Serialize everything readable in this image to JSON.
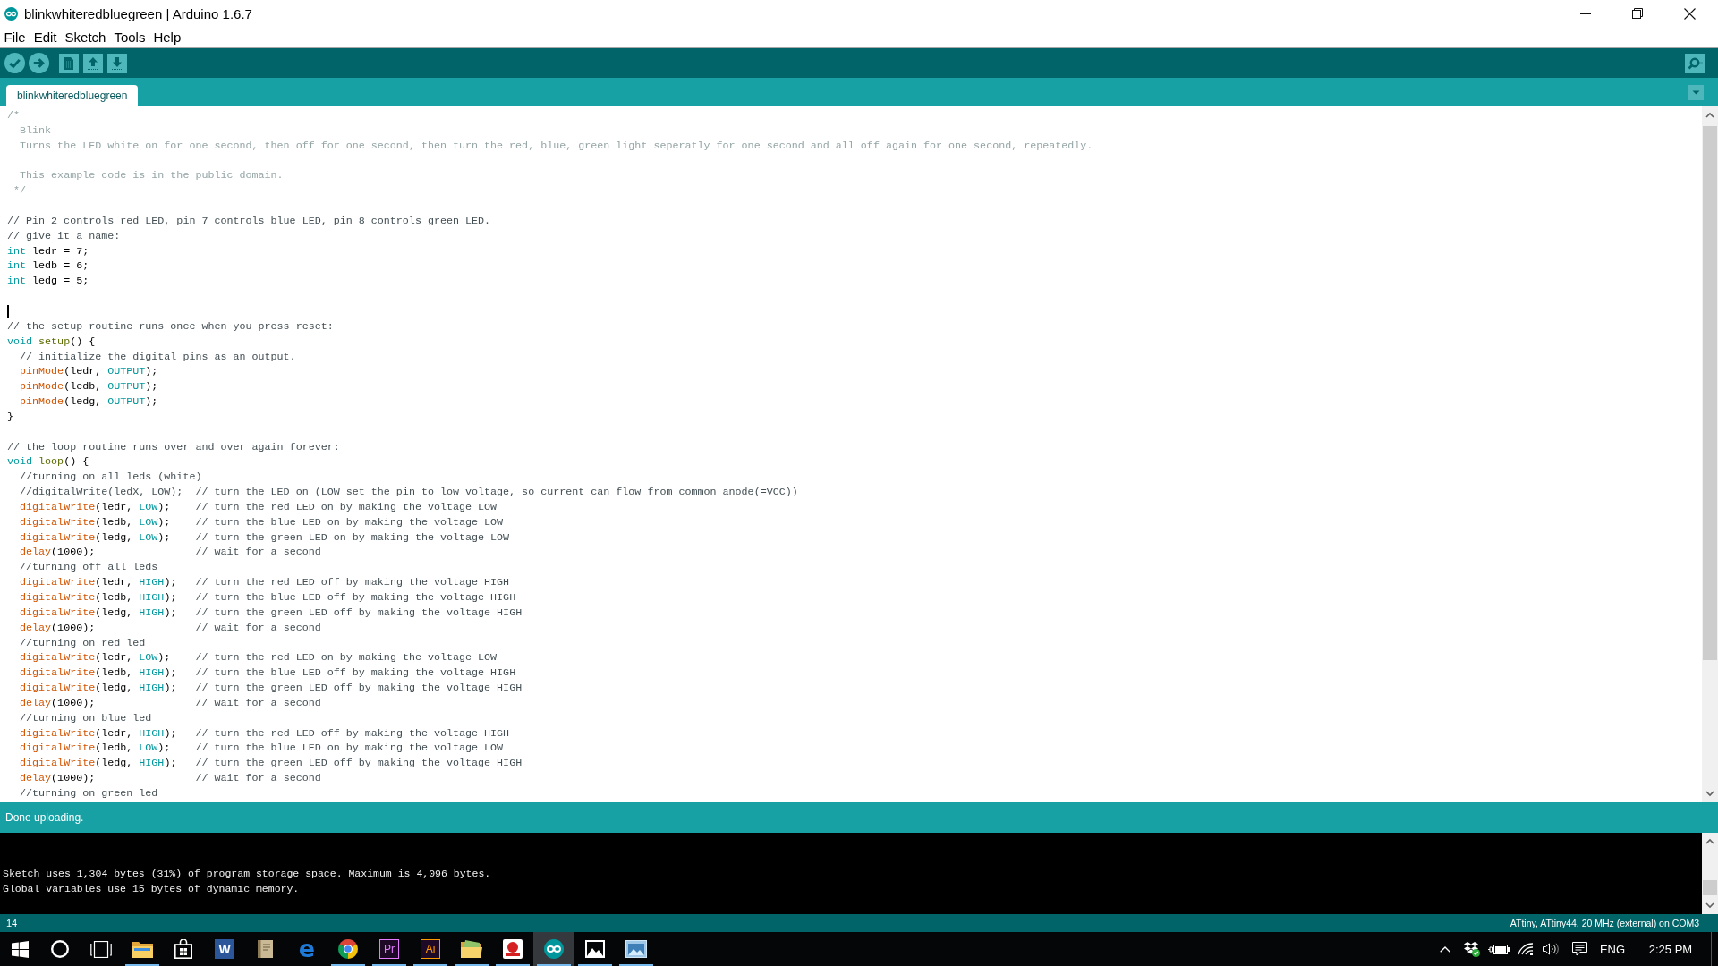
{
  "window": {
    "title": "blinkwhiteredbluegreen | Arduino 1.6.7"
  },
  "menu": [
    "File",
    "Edit",
    "Sketch",
    "Tools",
    "Help"
  ],
  "tabs": [
    {
      "label": "blinkwhiteredbluegreen",
      "selected": true
    }
  ],
  "editor": {
    "lines": [
      {
        "kind": "code",
        "tokens": [
          {
            "kind": "block_comment",
            "text": "/*"
          }
        ]
      },
      {
        "kind": "code",
        "tokens": [
          {
            "kind": "block_comment",
            "text": "  Blink"
          }
        ]
      },
      {
        "kind": "code",
        "tokens": [
          {
            "kind": "block_comment",
            "text": "  Turns the LED white on for one second, then off for one second, then turn the red, blue, green light seperatly for one second and all off again for one second, repeatedly."
          }
        ]
      },
      {
        "kind": "blank"
      },
      {
        "kind": "code",
        "tokens": [
          {
            "kind": "block_comment",
            "text": "  This example code is in the public domain."
          }
        ]
      },
      {
        "kind": "code",
        "tokens": [
          {
            "kind": "block_comment",
            "text": " */"
          }
        ]
      },
      {
        "kind": "blank"
      },
      {
        "kind": "code",
        "tokens": [
          {
            "kind": "comment",
            "text": "// Pin 2 controls red LED, pin 7 controls blue LED, pin 8 controls green LED."
          }
        ]
      },
      {
        "kind": "code",
        "tokens": [
          {
            "kind": "comment",
            "text": "// give it a name:"
          }
        ]
      },
      {
        "kind": "code",
        "tokens": [
          {
            "kind": "keyword",
            "text": "int"
          },
          {
            "kind": "plain",
            "text": " ledr = 7;"
          }
        ]
      },
      {
        "kind": "code",
        "tokens": [
          {
            "kind": "keyword",
            "text": "int"
          },
          {
            "kind": "plain",
            "text": " ledb = 6;"
          }
        ]
      },
      {
        "kind": "code",
        "tokens": [
          {
            "kind": "keyword",
            "text": "int"
          },
          {
            "kind": "plain",
            "text": " ledg = 5;"
          }
        ]
      },
      {
        "kind": "blank"
      },
      {
        "kind": "blank",
        "cursor": true
      },
      {
        "kind": "code",
        "tokens": [
          {
            "kind": "comment",
            "text": "// the setup routine runs once when you press reset:"
          }
        ]
      },
      {
        "kind": "code",
        "tokens": [
          {
            "kind": "keyword",
            "text": "void"
          },
          {
            "kind": "structure",
            "text": " setup"
          },
          {
            "kind": "plain",
            "text": "() {"
          }
        ]
      },
      {
        "kind": "code",
        "tokens": [
          {
            "kind": "comment",
            "text": "  // initialize the digital pins as an output."
          }
        ]
      },
      {
        "kind": "code",
        "tokens": [
          {
            "kind": "function",
            "text": "  pinMode"
          },
          {
            "kind": "plain",
            "text": "(ledr, "
          },
          {
            "kind": "keyword",
            "text": "OUTPUT"
          },
          {
            "kind": "plain",
            "text": ");"
          }
        ]
      },
      {
        "kind": "code",
        "tokens": [
          {
            "kind": "function",
            "text": "  pinMode"
          },
          {
            "kind": "plain",
            "text": "(ledb, "
          },
          {
            "kind": "keyword",
            "text": "OUTPUT"
          },
          {
            "kind": "plain",
            "text": ");"
          }
        ]
      },
      {
        "kind": "code",
        "tokens": [
          {
            "kind": "function",
            "text": "  pinMode"
          },
          {
            "kind": "plain",
            "text": "(ledg, "
          },
          {
            "kind": "keyword",
            "text": "OUTPUT"
          },
          {
            "kind": "plain",
            "text": ");"
          }
        ]
      },
      {
        "kind": "code",
        "tokens": [
          {
            "kind": "plain",
            "text": "}"
          }
        ]
      },
      {
        "kind": "blank"
      },
      {
        "kind": "code",
        "tokens": [
          {
            "kind": "comment",
            "text": "// the loop routine runs over and over again forever:"
          }
        ]
      },
      {
        "kind": "code",
        "tokens": [
          {
            "kind": "keyword",
            "text": "void"
          },
          {
            "kind": "structure",
            "text": " loop"
          },
          {
            "kind": "plain",
            "text": "() {"
          }
        ]
      },
      {
        "kind": "code",
        "tokens": [
          {
            "kind": "comment",
            "text": "  //turning on all leds (white)"
          }
        ]
      },
      {
        "kind": "code",
        "tokens": [
          {
            "kind": "comment",
            "text": "  //digitalWrite(ledX, LOW);  // turn the LED on (LOW set the pin to low voltage, so current can flow from common anode(=VCC))"
          }
        ]
      },
      {
        "kind": "code",
        "tokens": [
          {
            "kind": "function",
            "text": "  digitalWrite"
          },
          {
            "kind": "plain",
            "text": "(ledr, "
          },
          {
            "kind": "keyword",
            "text": "LOW"
          },
          {
            "kind": "plain",
            "text": ");    "
          },
          {
            "kind": "comment",
            "text": "// turn the red LED on by making the voltage LOW"
          }
        ]
      },
      {
        "kind": "code",
        "tokens": [
          {
            "kind": "function",
            "text": "  digitalWrite"
          },
          {
            "kind": "plain",
            "text": "(ledb, "
          },
          {
            "kind": "keyword",
            "text": "LOW"
          },
          {
            "kind": "plain",
            "text": ");    "
          },
          {
            "kind": "comment",
            "text": "// turn the blue LED on by making the voltage LOW"
          }
        ]
      },
      {
        "kind": "code",
        "tokens": [
          {
            "kind": "function",
            "text": "  digitalWrite"
          },
          {
            "kind": "plain",
            "text": "(ledg, "
          },
          {
            "kind": "keyword",
            "text": "LOW"
          },
          {
            "kind": "plain",
            "text": ");    "
          },
          {
            "kind": "comment",
            "text": "// turn the green LED on by making the voltage LOW"
          }
        ]
      },
      {
        "kind": "code",
        "tokens": [
          {
            "kind": "function",
            "text": "  delay"
          },
          {
            "kind": "plain",
            "text": "(1000);                "
          },
          {
            "kind": "comment",
            "text": "// wait for a second"
          }
        ]
      },
      {
        "kind": "code",
        "tokens": [
          {
            "kind": "comment",
            "text": "  //turning off all leds"
          }
        ]
      },
      {
        "kind": "code",
        "tokens": [
          {
            "kind": "function",
            "text": "  digitalWrite"
          },
          {
            "kind": "plain",
            "text": "(ledr, "
          },
          {
            "kind": "keyword",
            "text": "HIGH"
          },
          {
            "kind": "plain",
            "text": ");   "
          },
          {
            "kind": "comment",
            "text": "// turn the red LED off by making the voltage HIGH"
          }
        ]
      },
      {
        "kind": "code",
        "tokens": [
          {
            "kind": "function",
            "text": "  digitalWrite"
          },
          {
            "kind": "plain",
            "text": "(ledb, "
          },
          {
            "kind": "keyword",
            "text": "HIGH"
          },
          {
            "kind": "plain",
            "text": ");   "
          },
          {
            "kind": "comment",
            "text": "// turn the blue LED off by making the voltage HIGH"
          }
        ]
      },
      {
        "kind": "code",
        "tokens": [
          {
            "kind": "function",
            "text": "  digitalWrite"
          },
          {
            "kind": "plain",
            "text": "(ledg, "
          },
          {
            "kind": "keyword",
            "text": "HIGH"
          },
          {
            "kind": "plain",
            "text": ");   "
          },
          {
            "kind": "comment",
            "text": "// turn the green LED off by making the voltage HIGH"
          }
        ]
      },
      {
        "kind": "code",
        "tokens": [
          {
            "kind": "function",
            "text": "  delay"
          },
          {
            "kind": "plain",
            "text": "(1000);                "
          },
          {
            "kind": "comment",
            "text": "// wait for a second"
          }
        ]
      },
      {
        "kind": "code",
        "tokens": [
          {
            "kind": "comment",
            "text": "  //turning on red led"
          }
        ]
      },
      {
        "kind": "code",
        "tokens": [
          {
            "kind": "function",
            "text": "  digitalWrite"
          },
          {
            "kind": "plain",
            "text": "(ledr, "
          },
          {
            "kind": "keyword",
            "text": "LOW"
          },
          {
            "kind": "plain",
            "text": ");    "
          },
          {
            "kind": "comment",
            "text": "// turn the red LED on by making the voltage LOW"
          }
        ]
      },
      {
        "kind": "code",
        "tokens": [
          {
            "kind": "function",
            "text": "  digitalWrite"
          },
          {
            "kind": "plain",
            "text": "(ledb, "
          },
          {
            "kind": "keyword",
            "text": "HIGH"
          },
          {
            "kind": "plain",
            "text": ");   "
          },
          {
            "kind": "comment",
            "text": "// turn the blue LED off by making the voltage HIGH"
          }
        ]
      },
      {
        "kind": "code",
        "tokens": [
          {
            "kind": "function",
            "text": "  digitalWrite"
          },
          {
            "kind": "plain",
            "text": "(ledg, "
          },
          {
            "kind": "keyword",
            "text": "HIGH"
          },
          {
            "kind": "plain",
            "text": ");   "
          },
          {
            "kind": "comment",
            "text": "// turn the green LED off by making the voltage HIGH"
          }
        ]
      },
      {
        "kind": "code",
        "tokens": [
          {
            "kind": "function",
            "text": "  delay"
          },
          {
            "kind": "plain",
            "text": "(1000);                "
          },
          {
            "kind": "comment",
            "text": "// wait for a second"
          }
        ]
      },
      {
        "kind": "code",
        "tokens": [
          {
            "kind": "comment",
            "text": "  //turning on blue led"
          }
        ]
      },
      {
        "kind": "code",
        "tokens": [
          {
            "kind": "function",
            "text": "  digitalWrite"
          },
          {
            "kind": "plain",
            "text": "(ledr, "
          },
          {
            "kind": "keyword",
            "text": "HIGH"
          },
          {
            "kind": "plain",
            "text": ");   "
          },
          {
            "kind": "comment",
            "text": "// turn the red LED off by making the voltage HIGH"
          }
        ]
      },
      {
        "kind": "code",
        "tokens": [
          {
            "kind": "function",
            "text": "  digitalWrite"
          },
          {
            "kind": "plain",
            "text": "(ledb, "
          },
          {
            "kind": "keyword",
            "text": "LOW"
          },
          {
            "kind": "plain",
            "text": ");    "
          },
          {
            "kind": "comment",
            "text": "// turn the blue LED on by making the voltage LOW"
          }
        ]
      },
      {
        "kind": "code",
        "tokens": [
          {
            "kind": "function",
            "text": "  digitalWrite"
          },
          {
            "kind": "plain",
            "text": "(ledg, "
          },
          {
            "kind": "keyword",
            "text": "HIGH"
          },
          {
            "kind": "plain",
            "text": ");   "
          },
          {
            "kind": "comment",
            "text": "// turn the green LED off by making the voltage HIGH"
          }
        ]
      },
      {
        "kind": "code",
        "tokens": [
          {
            "kind": "function",
            "text": "  delay"
          },
          {
            "kind": "plain",
            "text": "(1000);                "
          },
          {
            "kind": "comment",
            "text": "// wait for a second"
          }
        ]
      },
      {
        "kind": "code",
        "tokens": [
          {
            "kind": "comment",
            "text": "  //turning on green led"
          }
        ]
      }
    ]
  },
  "message": "Done uploading.",
  "console": {
    "lines": [
      "Sketch uses 1,304 bytes (31%) of program storage space. Maximum is 4,096 bytes.",
      "Global variables use 15 bytes of dynamic memory."
    ]
  },
  "status_bar": {
    "line": "14",
    "board": "ATtiny, ATtiny44, 20 MHz (external) on COM3"
  },
  "taskbar": {
    "apps": [
      {
        "kind": "folder",
        "running": true,
        "selected": false
      },
      {
        "kind": "bag",
        "running": false,
        "selected": false
      },
      {
        "kind": "solid_tile",
        "label": "W",
        "color": "#2b579a",
        "running": false,
        "selected": false
      },
      {
        "kind": "notebook",
        "running": false,
        "selected": false
      },
      {
        "kind": "letter",
        "label": "e",
        "color": "#1e7ad6",
        "running": false,
        "selected": false
      },
      {
        "kind": "ring",
        "running": true,
        "selected": false
      },
      {
        "kind": "outline_tile",
        "label": "Pr",
        "color": "#e77bff",
        "running": true,
        "selected": false
      },
      {
        "kind": "outline_tile",
        "label": "Ai",
        "color": "#ff9a00",
        "running": true,
        "selected": false
      },
      {
        "kind": "folder_page",
        "running": true,
        "selected": false
      },
      {
        "kind": "badge",
        "running": true,
        "selected": false
      },
      {
        "kind": "infinity",
        "running": true,
        "selected": true
      },
      {
        "kind": "picture",
        "running": true,
        "selected": false
      },
      {
        "kind": "screen",
        "running": true,
        "selected": false
      }
    ],
    "tray": {
      "language": "ENG",
      "time": "2:25 PM"
    }
  }
}
